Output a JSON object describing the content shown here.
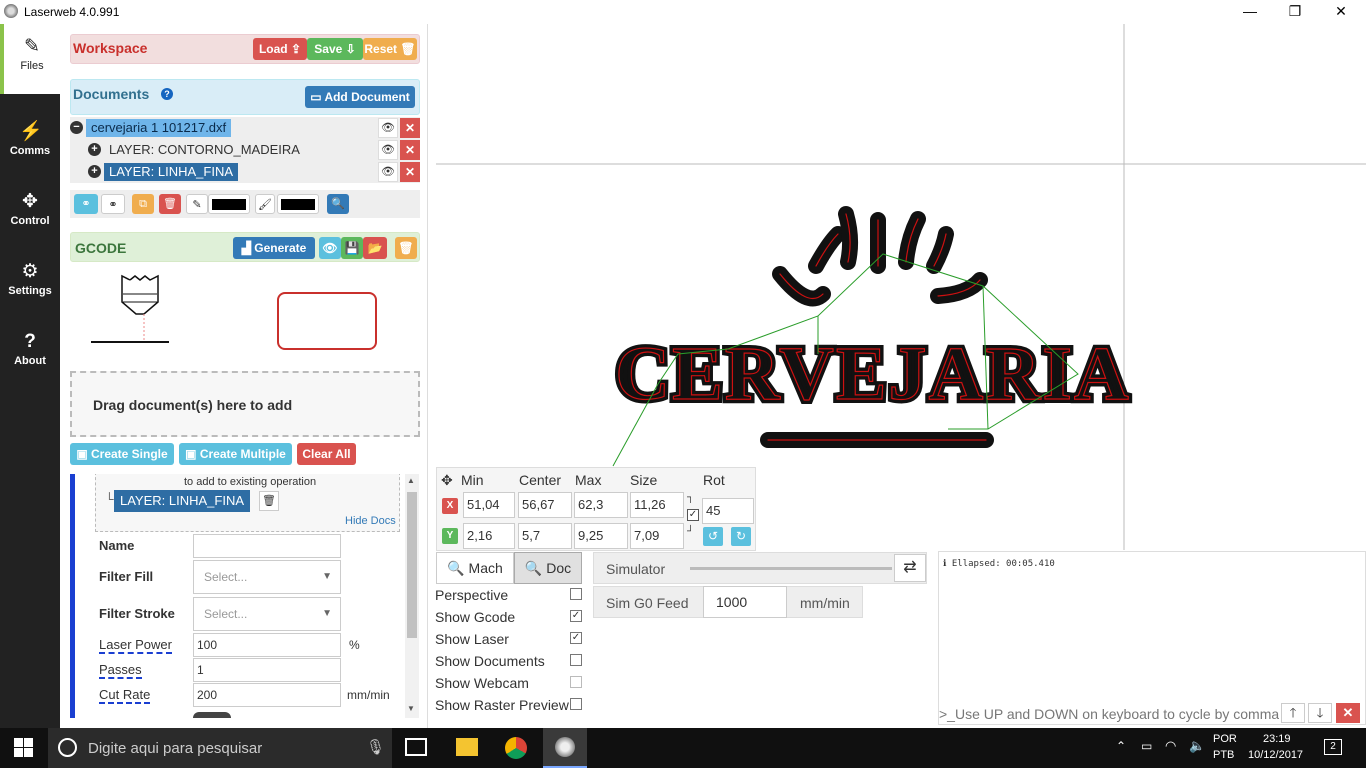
{
  "window": {
    "title": "Laserweb 4.0.991",
    "minimize": "—",
    "maximize": "❐",
    "close": "✕"
  },
  "nav": [
    {
      "label": "Files",
      "icon": "edit-icon"
    },
    {
      "label": "Comms",
      "icon": "plug-icon"
    },
    {
      "label": "Control",
      "icon": "arrows-icon"
    },
    {
      "label": "Settings",
      "icon": "gears-icon"
    },
    {
      "label": "About",
      "icon": "question-icon"
    }
  ],
  "workspace": {
    "title": "Workspace",
    "load": "Load",
    "save": "Save",
    "reset": "Reset"
  },
  "documents": {
    "title": "Documents",
    "add": "Add Document",
    "items": [
      {
        "label": "cervejaria 1 101217.dxf"
      },
      {
        "label": "LAYER: CONTORNO_MADEIRA"
      },
      {
        "label": "LAYER: LINHA_FINA"
      }
    ]
  },
  "gcode": {
    "title": "GCODE",
    "generate": "Generate"
  },
  "dropzone": "Drag document(s) here to add",
  "ops": {
    "create_single": "Create Single",
    "create_multiple": "Create Multiple",
    "clear_all": "Clear All"
  },
  "operation": {
    "hint": "to add to existing operation",
    "layer": "LAYER: LINHA_FINA",
    "hide_docs": "Hide Docs",
    "fields": [
      {
        "label": "Name",
        "value": "",
        "unit": ""
      },
      {
        "label": "Filter Fill",
        "value": "Select...",
        "unit": ""
      },
      {
        "label": "Filter Stroke",
        "value": "Select...",
        "unit": ""
      },
      {
        "label": "Laser Power",
        "value": "100",
        "unit": "%"
      },
      {
        "label": "Passes",
        "value": "1",
        "unit": ""
      },
      {
        "label": "Cut Rate",
        "value": "200",
        "unit": "mm/min"
      }
    ]
  },
  "transform": {
    "headers": [
      "Min",
      "Center",
      "Max",
      "Size",
      "Rot"
    ],
    "x": {
      "label": "X",
      "min": "51,04",
      "center": "56,67",
      "max": "62,3",
      "size": "11,26"
    },
    "y": {
      "label": "Y",
      "min": "2,16",
      "center": "5,7",
      "max": "9,25",
      "size": "7,09"
    },
    "rot": "45"
  },
  "viewbtns": {
    "mach": "Mach",
    "doc": "Doc"
  },
  "simulator": {
    "label": "Simulator",
    "g0_label": "Sim G0 Feed",
    "g0_value": "1000",
    "g0_unit": "mm/min"
  },
  "options": [
    {
      "label": "Perspective",
      "checked": false
    },
    {
      "label": "Show Gcode",
      "checked": true
    },
    {
      "label": "Show Laser",
      "checked": true
    },
    {
      "label": "Show Documents",
      "checked": false
    },
    {
      "label": "Show Webcam",
      "checked": false
    },
    {
      "label": "Show Raster Preview",
      "checked": false
    }
  ],
  "console": {
    "log": "Ellapsed: 00:05.410",
    "placeholder": ">_Use UP and DOWN on keyboard to cycle by comma"
  },
  "design_text": "CERVEJARIA",
  "taskbar": {
    "search": "Digite aqui para pesquisar",
    "lang1": "POR",
    "lang2": "PTB",
    "time": "23:19",
    "date": "10/12/2017",
    "notif": "2"
  },
  "colors": {
    "nav_bg": "#222222",
    "workspace_bg": "#f2dede",
    "documents_bg": "#d9edf7",
    "gcode_bg": "#dff0d8",
    "outline_red": "#cc1111"
  }
}
